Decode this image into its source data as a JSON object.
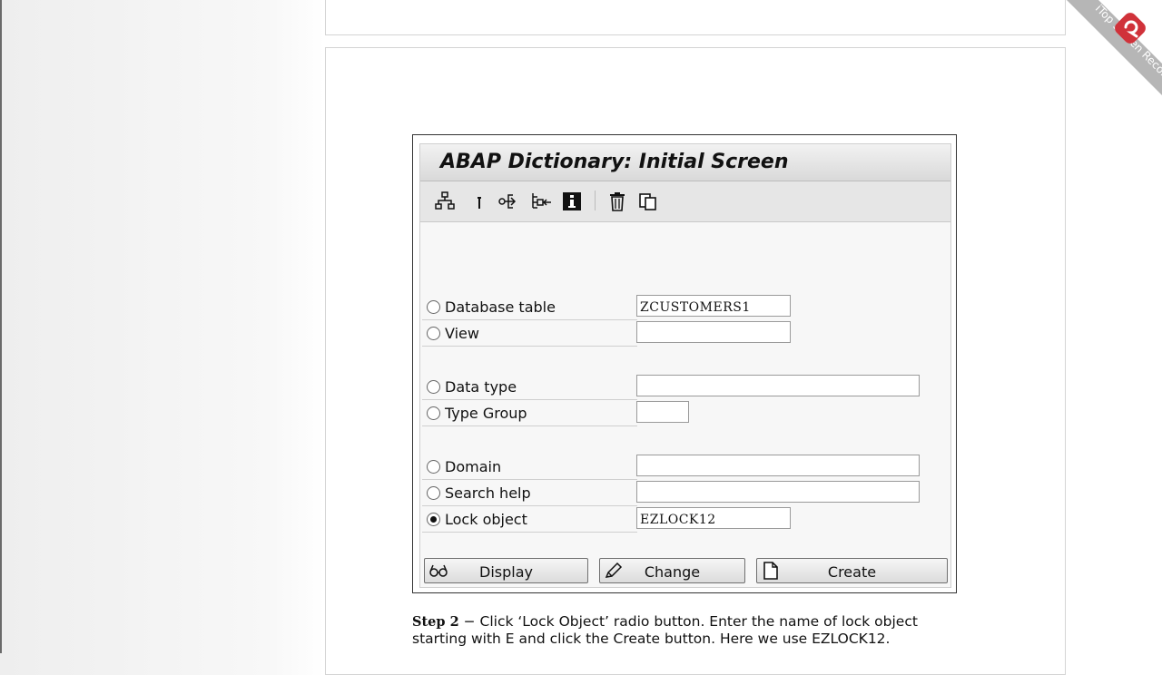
{
  "window": {
    "title": "ABAP Dictionary: Initial Screen"
  },
  "toolbar": {
    "icons": [
      "hierarchy-icon",
      "pin-icon",
      "usage-icon",
      "transport-icon",
      "info-icon",
      "delete-icon",
      "copy-icon"
    ]
  },
  "form": {
    "rows": [
      {
        "label": "Database table",
        "value": "ZCUSTOMERS1",
        "checked": false
      },
      {
        "label": "View",
        "value": "",
        "checked": false
      },
      {
        "label": "Data type",
        "value": "",
        "checked": false
      },
      {
        "label": "Type Group",
        "value": "",
        "checked": false
      },
      {
        "label": "Domain",
        "value": "",
        "checked": false
      },
      {
        "label": "Search help",
        "value": "",
        "checked": false
      },
      {
        "label": "Lock object",
        "value": "EZLOCK12",
        "checked": true
      }
    ]
  },
  "buttons": {
    "display": "Display",
    "change": "Change",
    "create": "Create"
  },
  "caption": {
    "step": "Step 2",
    "text": " − Click ‘Lock Object’ radio button. Enter the name of lock object starting with E and click the Create button. Here we use EZLOCK12."
  },
  "watermark": {
    "text": "iTop Screen Recorder",
    "accent": "#d0323a"
  }
}
